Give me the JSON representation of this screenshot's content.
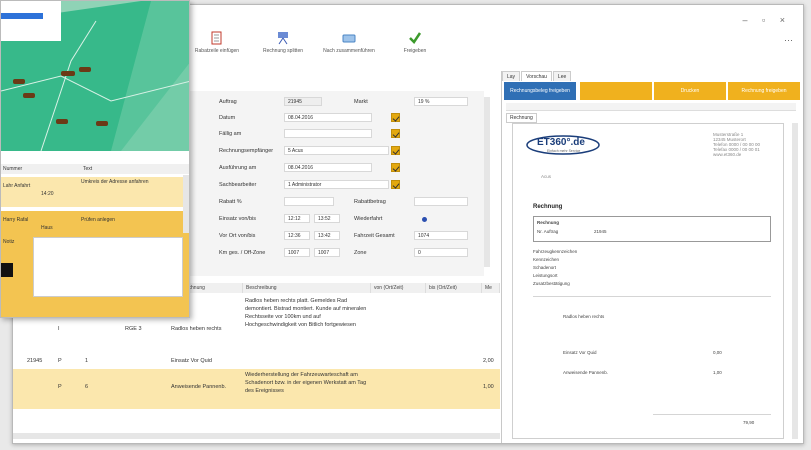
{
  "toolbar": {
    "items": [
      {
        "label": "Rabatzeile einfügen",
        "icon": "document-edit-icon"
      },
      {
        "label": "Rechnung splitten",
        "icon": "split-icon"
      },
      {
        "label": "Nach zusammenführen",
        "icon": "merge-icon"
      },
      {
        "label": "Freigeben",
        "icon": "checkmark-icon"
      }
    ],
    "window_controls": "–  ▫  ×",
    "more": "⋯"
  },
  "form": {
    "auftrag_label": "Auftrag",
    "auftrag_value": "21945",
    "markt_label": "Markt",
    "markt_value": "19 %",
    "datum_label": "Datum",
    "datum_value": "08.04.2016",
    "faellig_label": "Fällig am",
    "faellig_value": "",
    "rechnungsempf_label": "Rechnungsempfänger",
    "rechnungsempf_value": "5  Acus",
    "ausfuehrung_label": "Ausführung am",
    "ausfuehrung_value": "08.04.2016",
    "sachbearbeiter_label": "Sachbearbeiter",
    "sachbearbeiter_value": "1  Administrator",
    "rabatt_label": "Rabatt %",
    "rabatt_value": "",
    "rabattbetrag_label": "Rabattbetrag",
    "einsatz_label": "Einsatz von/bis",
    "einsatz_from": "12:12",
    "einsatz_to": "13:52",
    "wiederfahrt_label": "Wiederfahrt",
    "vorort_label": "Vor Ort von/bis",
    "vorort_from": "12:36",
    "vorort_to": "13:42",
    "fahrzeit_label": "Fahrzeit Gesamt",
    "fahrzeit_value": "1074",
    "km_label": "Km ges. / Off-Zone",
    "km_from": "1007",
    "km_to": "1007",
    "zone_label": "Zone",
    "zone_value": "0"
  },
  "table": {
    "headers": [
      "Bezeichnung",
      "Beschreibung",
      "von (Ort/Zeit)",
      "bis (Ort/Zeit)",
      "Me"
    ],
    "rows": [
      {
        "c0": "I",
        "c1": "RGE 3",
        "c2": "Radlos heben rechts",
        "desc": "Radlos heben rechts platt. Gemeldes Rad demontiert. Bistrad montiert. Kunde auf mineralen Rechtsseite vor 100km und auf Hochgeschwindigkeit von Bitlich fortgewiesen",
        "amount": ""
      },
      {
        "c0": "21945",
        "c1": "P",
        "c2": "1",
        "desc": "Einsatz Vor Quid",
        "amount": "2,00"
      },
      {
        "c0": "P",
        "c1": "6",
        "c2": "Anweisende Pannenb.",
        "desc": "Wiederherstellung der Fahrzeuwarteschaft am Schadenort bzw. in der eigenen Werkstatt am Tag des Ereignisses",
        "amount": "1,00"
      }
    ]
  },
  "panel": {
    "tabs": [
      "Lay",
      "Vorschau",
      "Lee"
    ],
    "buttons": [
      "Rechnungsbeleg freigeben",
      "Drucken",
      "Rechnung freigeben"
    ],
    "subtab": "Rechnung",
    "logo": "ET360°.de",
    "logo_tag": "Einfach mehr Service",
    "doc_title": "Rechnung",
    "doc_lines": [
      "Rechnung",
      "Nr. Auftrag",
      "21945",
      "Fahrzeugkennzeichen",
      "Kennzeichen",
      "Schadenort",
      "Leistungsort",
      "Zusatzbestätigung",
      "Radlos heben rechts",
      "Einsatz Vor Quid",
      "Anweisende Pannenb."
    ],
    "amounts": [
      "0,00",
      "1,00",
      "79,90"
    ]
  },
  "map_window": {
    "list_headers": [
      "Nummer",
      "Text"
    ],
    "rows": [
      {
        "a": "Lahr Anfahrt",
        "b": "Umkreis der Adresse anfahren",
        "c": "14:20"
      },
      {
        "a": "Harry Rafal",
        "b": "Prüfen anlegen",
        "c": "Haus"
      }
    ],
    "panel_label": "Notiz"
  },
  "colors": {
    "accent": "#f0b11e",
    "blue": "#2b6cb0",
    "map_green": "#3fbf8f",
    "highlight": "#fbe7ad"
  }
}
